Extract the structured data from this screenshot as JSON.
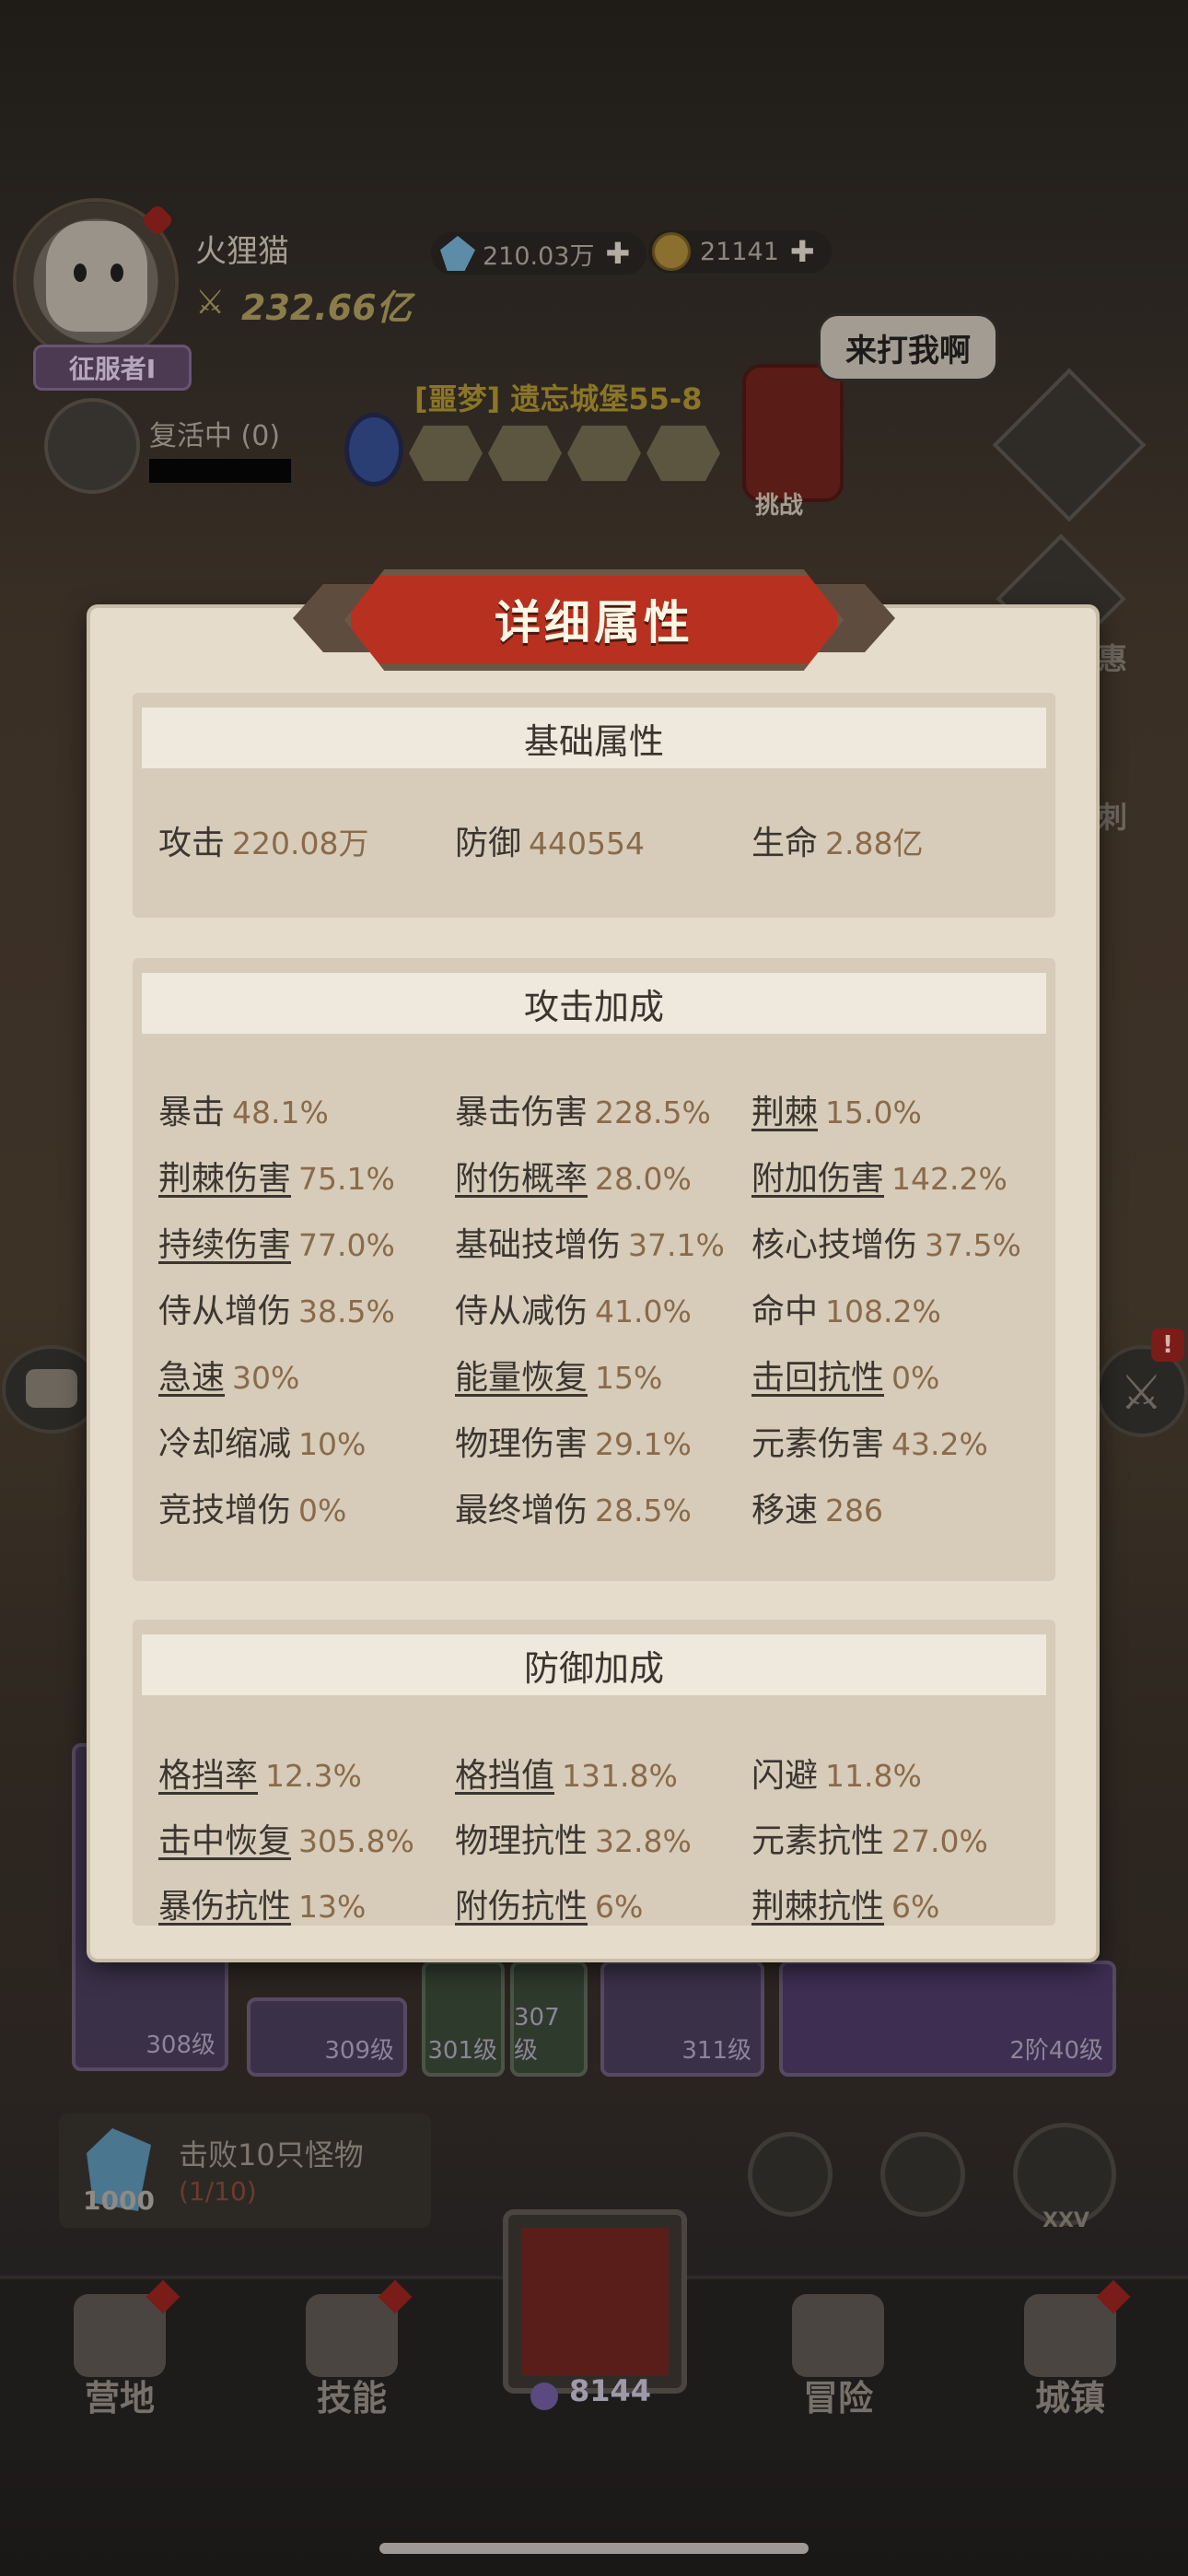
{
  "player": {
    "name": "火狸猫",
    "power": "232.66亿",
    "rank_badge": "征服者Ⅰ",
    "revive_status": "复活中 (0)"
  },
  "currencies": {
    "gems": "210.03万",
    "coins": "21141"
  },
  "stage": {
    "title": "[噩梦] 遗忘城堡55-8",
    "boss_speech": "来打我啊",
    "boss_label": "挑战"
  },
  "side_labels": {
    "right_1": "惠",
    "right_2": "刺"
  },
  "equipment_levels": [
    "308级",
    "309级",
    "301级",
    "307级",
    "311级",
    "2阶40级"
  ],
  "quest": {
    "reward_count": "1000",
    "title": "击败10只怪物",
    "progress": "(1/10)"
  },
  "boss_emblem_label": "XXV",
  "alert_badge": "!",
  "nav": {
    "items": [
      "营地",
      "技能",
      "冒险",
      "城镇"
    ],
    "center_value": "8144"
  },
  "modal": {
    "title": "详细属性",
    "sections": {
      "basic": {
        "title": "基础属性",
        "rows": [
          [
            {
              "name": "攻击",
              "value": "220.08万"
            },
            {
              "name": "防御",
              "value": "440554"
            },
            {
              "name": "生命",
              "value": "2.88亿"
            }
          ]
        ]
      },
      "attack": {
        "title": "攻击加成",
        "rows": [
          [
            {
              "name": "暴击",
              "value": "48.1%"
            },
            {
              "name": "暴击伤害",
              "value": "228.5%"
            },
            {
              "name": "荆棘",
              "value": "15.0%"
            }
          ],
          [
            {
              "name": "荆棘伤害",
              "value": "75.1%"
            },
            {
              "name": "附伤概率",
              "value": "28.0%"
            },
            {
              "name": "附加伤害",
              "value": "142.2%"
            }
          ],
          [
            {
              "name": "持续伤害",
              "value": "77.0%"
            },
            {
              "name": "基础技增伤",
              "value": "37.1%"
            },
            {
              "name": "核心技增伤",
              "value": "37.5%"
            }
          ],
          [
            {
              "name": "侍从增伤",
              "value": "38.5%"
            },
            {
              "name": "侍从减伤",
              "value": "41.0%"
            },
            {
              "name": "命中",
              "value": "108.2%"
            }
          ],
          [
            {
              "name": "急速",
              "value": "30%"
            },
            {
              "name": "能量恢复",
              "value": "15%"
            },
            {
              "name": "击回抗性",
              "value": "0%"
            }
          ],
          [
            {
              "name": "冷却缩减",
              "value": "10%"
            },
            {
              "name": "物理伤害",
              "value": "29.1%"
            },
            {
              "name": "元素伤害",
              "value": "43.2%"
            }
          ],
          [
            {
              "name": "竞技增伤",
              "value": "0%"
            },
            {
              "name": "最终增伤",
              "value": "28.5%"
            },
            {
              "name": "移速",
              "value": "286"
            }
          ]
        ]
      },
      "defense": {
        "title": "防御加成",
        "rows": [
          [
            {
              "name": "格挡率",
              "value": "12.3%"
            },
            {
              "name": "格挡值",
              "value": "131.8%"
            },
            {
              "name": "闪避",
              "value": "11.8%"
            }
          ],
          [
            {
              "name": "击中恢复",
              "value": "305.8%"
            },
            {
              "name": "物理抗性",
              "value": "32.8%"
            },
            {
              "name": "元素抗性",
              "value": "27.0%"
            }
          ],
          [
            {
              "name": "暴伤抗性",
              "value": "13%"
            },
            {
              "name": "附伤抗性",
              "value": "6%"
            },
            {
              "name": "荆棘抗性",
              "value": "6%"
            }
          ]
        ]
      }
    }
  }
}
